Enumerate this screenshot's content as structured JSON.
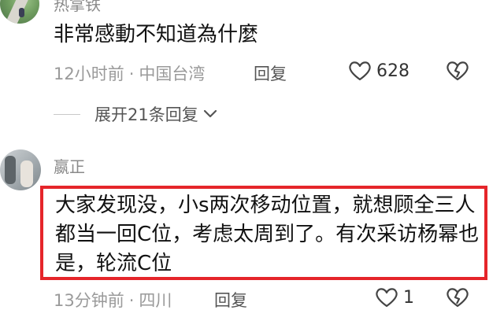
{
  "comments": [
    {
      "username": "热拿铁",
      "text": "非常感動不知道為什麼",
      "time": "12小时前",
      "location": "中国台湾",
      "reply_label": "回复",
      "likes": "628",
      "expand_label": "展开21条回复"
    },
    {
      "username": "嬴正",
      "text": "大家发现没，小s两次移动位置，就想顾全三人都当一回C位，考虑太周到了。有次采访杨幂也是，轮流C位",
      "time": "13分钟前",
      "location": "四川",
      "reply_label": "回复",
      "likes": "1"
    }
  ],
  "meta_separator": "·",
  "colors": {
    "highlight": "#e5252a",
    "meta": "#9a9a9a"
  },
  "icons": [
    "heart-outline-icon",
    "broken-heart-icon",
    "chevron-down-icon"
  ]
}
